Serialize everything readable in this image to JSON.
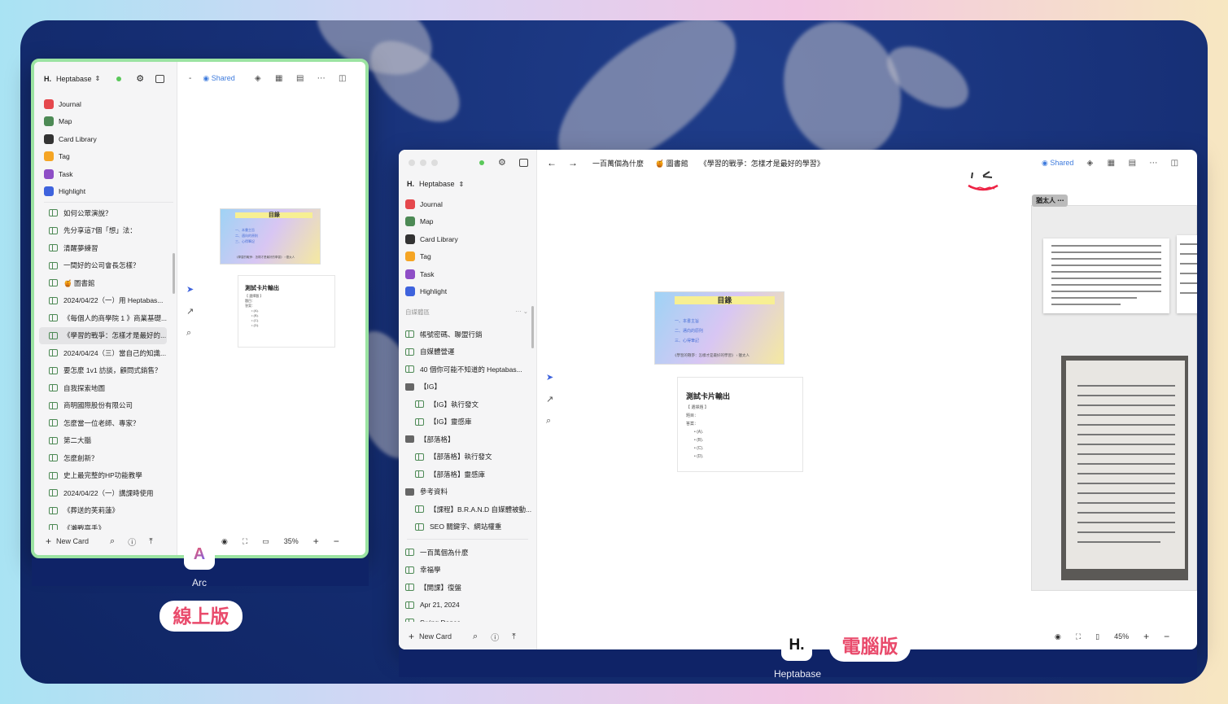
{
  "arc_window": {
    "workspace": "Heptabase",
    "shared_label": "Shared",
    "tools": [
      {
        "name": "Journal",
        "color": "#e5484d",
        "icon": "calendar-icon"
      },
      {
        "name": "Map",
        "color": "#4d8a55",
        "icon": "map-icon"
      },
      {
        "name": "Card Library",
        "color": "#333333",
        "icon": "cards-icon"
      },
      {
        "name": "Tag",
        "color": "#f5a524",
        "icon": "hash-icon"
      },
      {
        "name": "Task",
        "color": "#8e4ec6",
        "icon": "task-icon"
      },
      {
        "name": "Highlight",
        "color": "#3e63dd",
        "icon": "highlight-icon"
      }
    ],
    "pages": [
      "如何公眾演說？",
      "先分享這7個「想」法：",
      "清醒夢練習",
      "一間好的公司會長怎樣？",
      "🍯 圖書館",
      "2024/04/22（一）用 Heptabas...",
      "《每個人的商學院 1 》商業基礎...",
      "《學習的戰爭：怎樣才是最好的...",
      "2024/04/24（三）當自己的知識...",
      "要怎麼 1v1 訪談，顧問式銷售？",
      "自我探索地圖",
      "商明國際股份有限公司",
      "怎麼當一位老師、專家？",
      "第二大腦",
      "怎麼創新？",
      "史上最完整的HP功能教學",
      "2024/04/22（一）講課時使用",
      "《葬送的芙莉蓮》",
      "《瀨戰高手》"
    ],
    "selected_page_index": 7,
    "new_card": "New Card",
    "zoom": "35%"
  },
  "toc_card": {
    "title": "目錄",
    "lines": [
      "一、本書主旨",
      "二、邁向的原則",
      "三、心得筆記"
    ],
    "footer": "《學習的戰爭：怎樣才是最好的學習》 › 獵太人"
  },
  "test_card": {
    "title": "測試卡片輸出",
    "line1": "【 選擇題 】",
    "line2": "題目：",
    "line3": "答案：",
    "items": [
      "(A).",
      "(B).",
      "(C).",
      "(D)."
    ]
  },
  "desktop_window": {
    "breadcrumbs": [
      "一百萬個為什麼",
      "🍯 圖書館",
      "《學習的戰爭：怎樣才是最好的學習》"
    ],
    "shared_label": "Shared",
    "workspace": "Heptabase",
    "tools": [
      "Journal",
      "Map",
      "Card Library",
      "Tag",
      "Task",
      "Highlight"
    ],
    "section": "自媒體區",
    "pages": [
      {
        "t": "帳號密碼、聯盟行銷",
        "k": "page",
        "ind": false
      },
      {
        "t": "自媒體營運",
        "k": "page",
        "ind": false
      },
      {
        "t": "40 個你可能不知道的 Heptabas...",
        "k": "page",
        "ind": false
      },
      {
        "t": "【IG】",
        "k": "folder",
        "ind": false
      },
      {
        "t": "【IG】執行發文",
        "k": "page",
        "ind": true
      },
      {
        "t": "【IG】靈感庫",
        "k": "page",
        "ind": true
      },
      {
        "t": "【部落格】",
        "k": "folder",
        "ind": false
      },
      {
        "t": "【部落格】執行發文",
        "k": "page",
        "ind": true
      },
      {
        "t": "【部落格】靈感庫",
        "k": "page",
        "ind": true
      },
      {
        "t": "參考資料",
        "k": "folder",
        "ind": false
      },
      {
        "t": "【課程】B.R.A.N.D 自媒體被動...",
        "k": "page",
        "ind": true
      },
      {
        "t": "SEO 關鍵字、網站權重",
        "k": "page",
        "ind": true
      }
    ],
    "pages2": [
      "一百萬個為什麼",
      "幸福學",
      "【開課】復盤",
      "Apr 21, 2024",
      "Swing Dance"
    ],
    "new_card": "New Card",
    "zoom": "45%",
    "tag_label": "猶太人"
  },
  "labels": {
    "arc": "Arc",
    "online": "線上版",
    "heptabase": "Heptabase",
    "desktop": "電腦版",
    "hept_logo": "H."
  }
}
